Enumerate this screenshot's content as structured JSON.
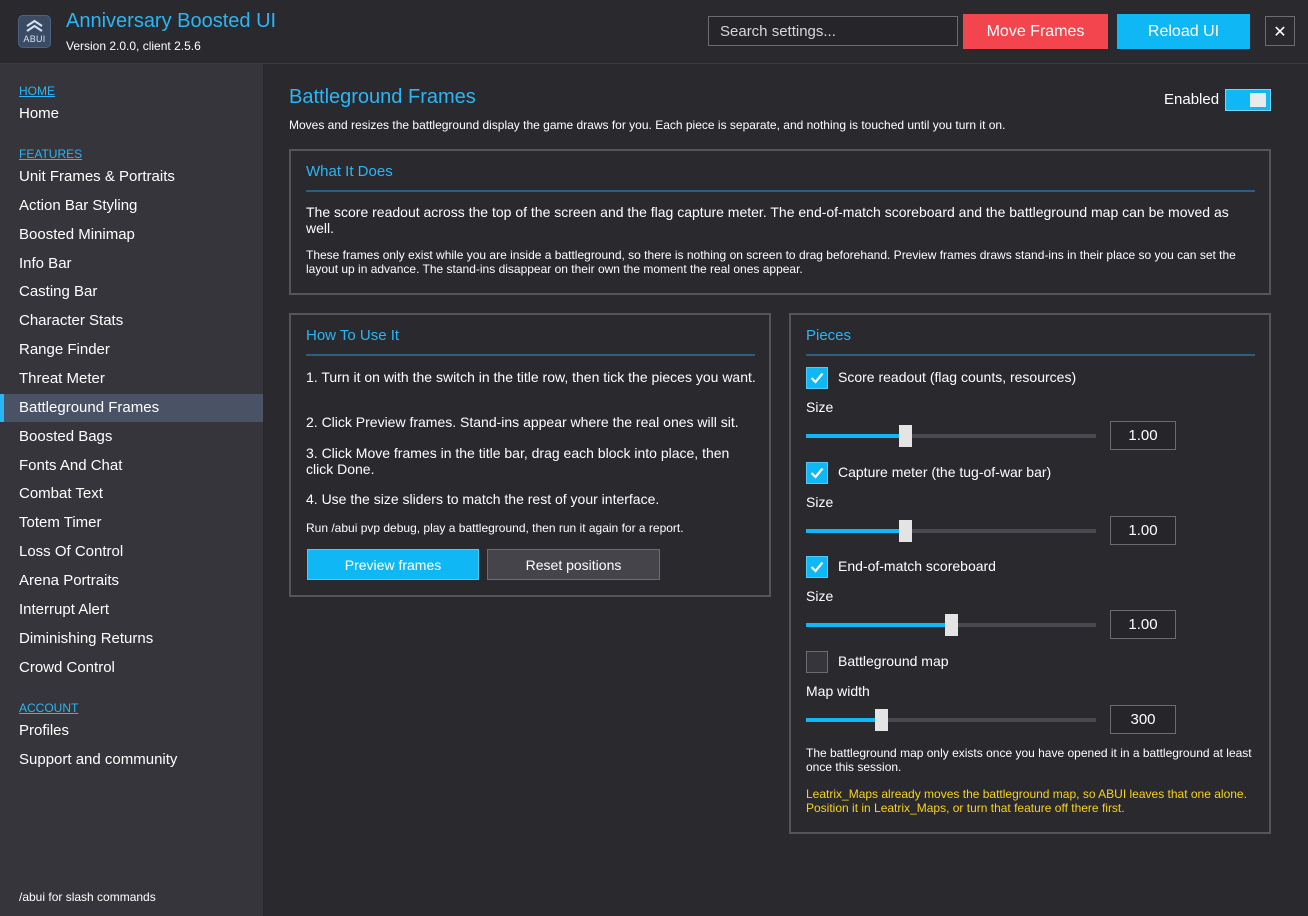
{
  "header": {
    "logo_text": "ABUI",
    "title": "Anniversary Boosted UI",
    "version": "Version 2.0.0, client 2.5.6",
    "search_placeholder": "Search settings...",
    "move_frames_label": "Move Frames",
    "reload_ui_label": "Reload UI",
    "close_glyph": "✕",
    "accent_color": "#2ab6f6",
    "move_color": "#f2454d",
    "reload_color": "#10b7f5"
  },
  "sidebar": {
    "home_section": "HOME",
    "home_items": [
      "Home"
    ],
    "features_section": "FEATURES",
    "feature_items": [
      "Unit Frames & Portraits",
      "Action Bar Styling",
      "Boosted Minimap",
      "Info Bar",
      "Casting Bar",
      "Character Stats",
      "Range Finder",
      "Threat Meter",
      "Battleground Frames",
      "Boosted Bags",
      "Fonts And Chat",
      "Combat Text",
      "Totem Timer",
      "Loss Of Control",
      "Arena Portraits",
      "Interrupt Alert",
      "Diminishing Returns",
      "Crowd Control"
    ],
    "active_item": "Battleground Frames",
    "account_section": "ACCOUNT",
    "account_items": [
      "Profiles",
      "Support and community"
    ],
    "footer": "/abui for slash commands"
  },
  "main": {
    "title": "Battleground Frames",
    "description": "Moves and resizes the battleground display the game draws for you.  Each piece is separate, and nothing is touched until you turn it on.",
    "enabled_label": "Enabled",
    "enabled": true,
    "what_it_does": {
      "title": "What It Does",
      "body": "The score readout across the top of the screen and the flag capture meter.  The end-of-match scoreboard and the battleground map can be moved as well.",
      "note": "These frames only exist while you are inside a battleground, so there is nothing on screen to drag beforehand.  Preview frames draws stand-ins in their place so you can set the layout up in advance.  The stand-ins disappear on their own the moment the real ones appear."
    },
    "how_to_use": {
      "title": "How To Use It",
      "steps": [
        "1.  Turn it on with the switch in the title row, then tick the pieces you want.",
        "2.  Click Preview frames.  Stand-ins appear where the real ones will sit.",
        "3.  Click Move frames in the title bar, drag each block into place, then click Done.",
        "4.  Use the size sliders to match the rest of your interface."
      ],
      "debug_note": "Run /abui pvp debug, play a battleground, then run it again for a report.",
      "preview_label": "Preview frames",
      "reset_label": "Reset positions"
    },
    "pieces": {
      "title": "Pieces",
      "items": [
        {
          "label": "Score readout (flag counts, resources)",
          "checked": true,
          "slider_label": "Size",
          "value": "1.00",
          "fraction": 0.34
        },
        {
          "label": "Capture meter (the tug-of-war bar)",
          "checked": true,
          "slider_label": "Size",
          "value": "1.00",
          "fraction": 0.34
        },
        {
          "label": "End-of-match scoreboard",
          "checked": true,
          "slider_label": "Size",
          "value": "1.00",
          "fraction": 0.5
        },
        {
          "label": "Battleground map",
          "checked": false,
          "slider_label": "Map width",
          "value": "300",
          "fraction": 0.26
        }
      ],
      "note": "The battleground map only exists once you have opened it in a battleground at least once this session.",
      "warning": "Leatrix_Maps already moves the battleground map, so ABUI leaves that one alone. Position it in Leatrix_Maps, or turn that feature off there first.",
      "warning_color": "#f7d21c"
    }
  }
}
